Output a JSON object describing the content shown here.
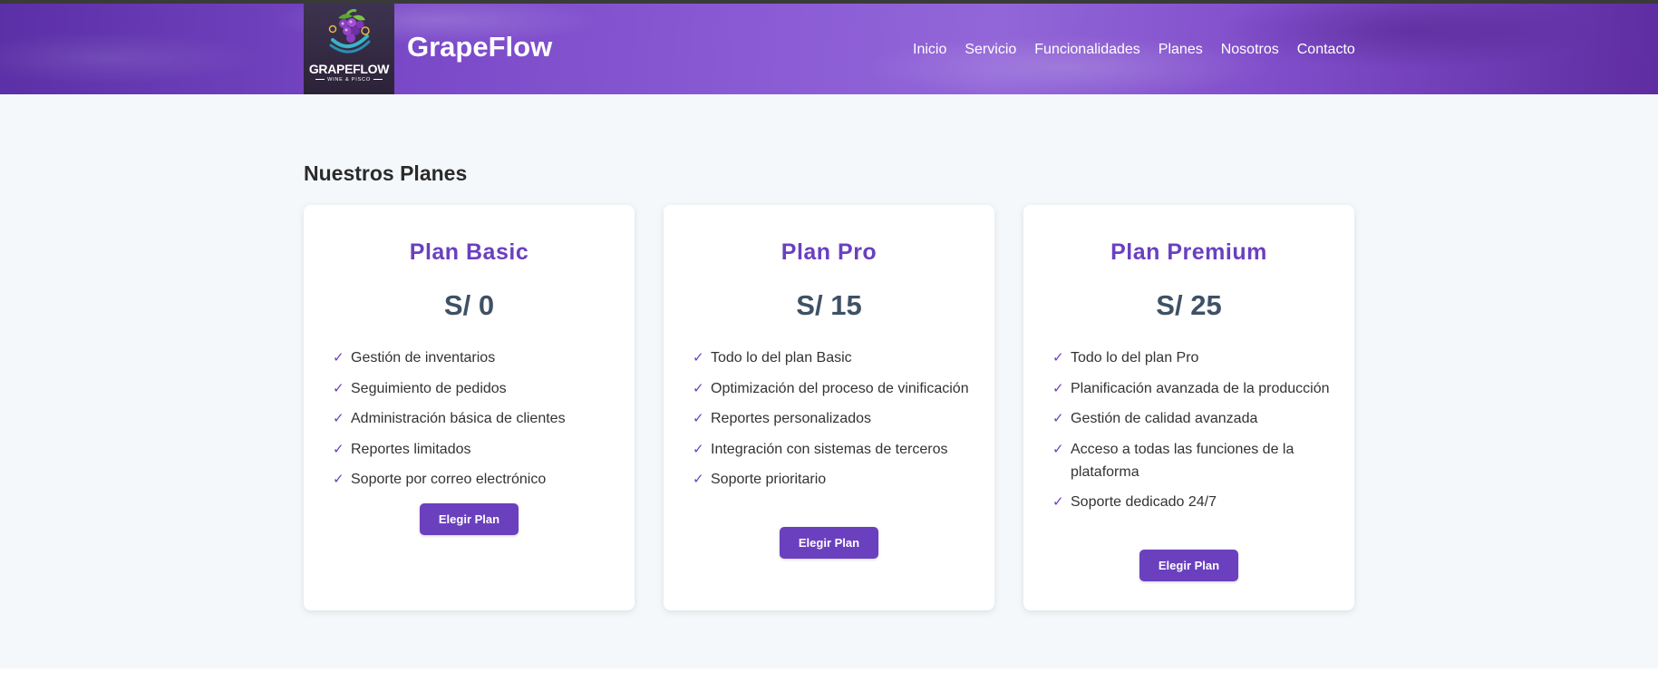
{
  "header": {
    "logo": {
      "wordmark": "GRAPEFLOW",
      "tagline": "WINE & PISCO"
    },
    "brand": "GrapeFlow",
    "nav": [
      "Inicio",
      "Servicio",
      "Funcionalidades",
      "Planes",
      "Nosotros",
      "Contacto"
    ]
  },
  "main": {
    "title": "Nuestros Planes",
    "plans": [
      {
        "name": "Plan Basic",
        "price": "S/ 0",
        "features": [
          "Gestión de inventarios",
          "Seguimiento de pedidos",
          "Administración básica de clientes",
          "Reportes limitados",
          "Soporte por correo electrónico"
        ],
        "button": "Elegir Plan"
      },
      {
        "name": "Plan Pro",
        "price": "S/ 15",
        "features": [
          "Todo lo del plan Basic",
          "Optimización del proceso de vinificación",
          "Reportes personalizados",
          "Integración con sistemas de terceros",
          "Soporte prioritario"
        ],
        "button": "Elegir Plan"
      },
      {
        "name": "Plan Premium",
        "price": "S/ 25",
        "features": [
          "Todo lo del plan Pro",
          "Planificación avanzada de la producción",
          "Gestión de calidad avanzada",
          "Acceso a todas las funciones de la plataforma",
          "Soporte dedicado 24/7"
        ],
        "button": "Elegir Plan"
      }
    ]
  },
  "icons": {
    "feature_check": "✓"
  },
  "colors": {
    "accent": "#6a40bf",
    "price": "#3e5165",
    "header_gradient_mid": "#8a5ad4",
    "page_bg": "#f5f8fb"
  }
}
